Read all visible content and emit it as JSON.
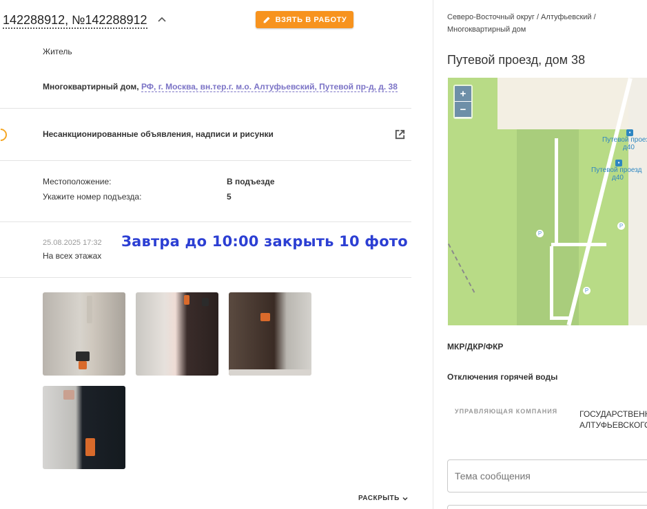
{
  "ticket": {
    "title": "142288912, №142288912",
    "take_button": "ВЗЯТЬ В РАБОТУ"
  },
  "details": {
    "author_type": "Житель",
    "object_type": "Многоквартирный дом,",
    "object_address": "РФ, г. Москва, вн.тер.г. м.о. Алтуфьевский, Путевой пр-д, д. 38",
    "category": "Несанкционированные объявления, надписи и рисунки",
    "location_label": "Местоположение:",
    "location_value": "В подъезде",
    "entrance_label": "Укажите номер подъезда:",
    "entrance_value": "5",
    "date": "25.08.2025 17:32",
    "comment": "На всех этажах",
    "note": "Завтра до 10:00 закрыть 10 фото",
    "expand_label": "РАСКРЫТЬ"
  },
  "side": {
    "breadcrumb": "Северо-Восточный округ / Алтуфьевский / Многоквартирный дом",
    "address": "Путевой проезд, дом 38",
    "map": {
      "zoom_in": "+",
      "zoom_out": "−",
      "bus1": "Путевой проезд",
      "bus1_num": "д40",
      "bus2": "Путевой проезд",
      "bus2_num": "д40",
      "parking": "P"
    },
    "mkr": "МКР/ДКР/ФКР",
    "hot_water": "Отключения горячей воды",
    "mgmt_label": "УПРАВЛЯЮЩАЯ КОМПАНИЯ",
    "mgmt_value_1": "ГОСУДАРСТВЕННОЕ",
    "mgmt_value_2": "АЛТУФЬЕВСКОГО",
    "topic_placeholder": "Тема сообщения"
  },
  "colors": {
    "accent": "#f7931e",
    "link": "#7b73c6",
    "note": "#2c3fd3"
  }
}
